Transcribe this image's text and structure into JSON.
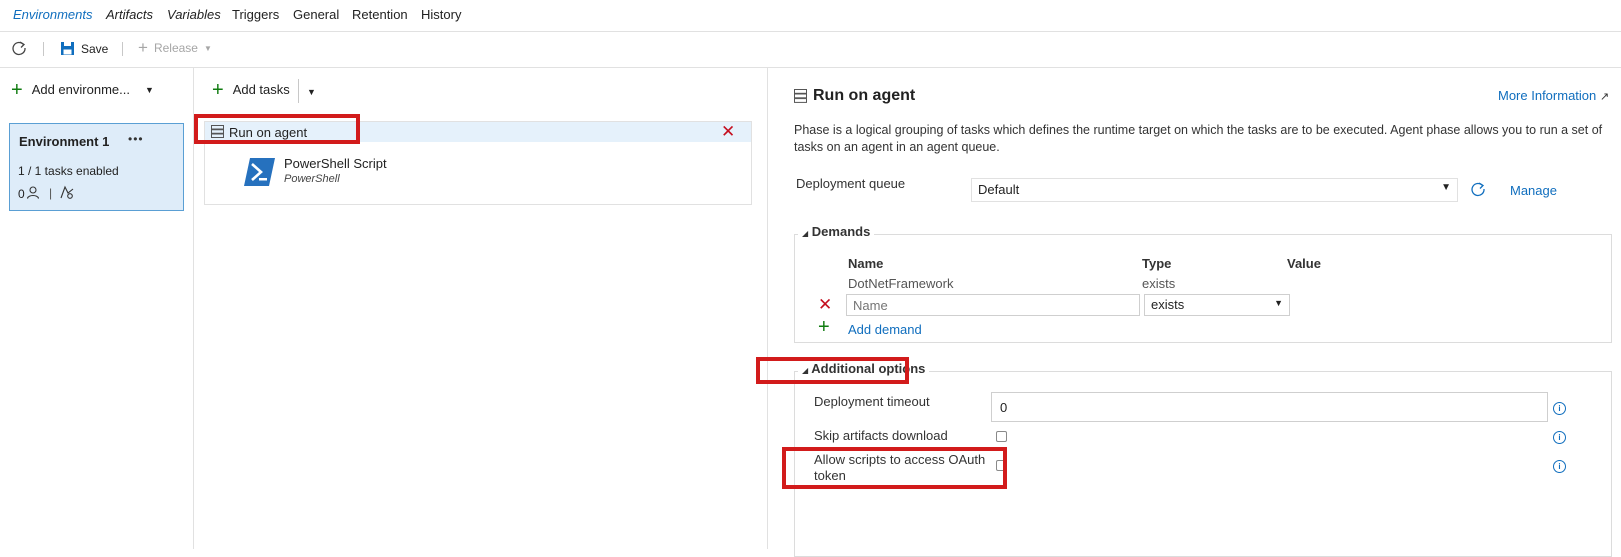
{
  "tabs": [
    {
      "label": "Environments",
      "active": true
    },
    {
      "label": "Artifacts"
    },
    {
      "label": "Variables"
    },
    {
      "label": "Triggers"
    },
    {
      "label": "General"
    },
    {
      "label": "Retention"
    },
    {
      "label": "History"
    }
  ],
  "toolbar": {
    "save_label": "Save",
    "release_label": "Release"
  },
  "left": {
    "add_env_label": "Add environme...",
    "env": {
      "name": "Environment 1",
      "more": "•••",
      "tasks_enabled": "1 / 1 tasks enabled",
      "approvers_count": "0",
      "separator": "|"
    }
  },
  "middle": {
    "add_tasks_label": "Add tasks",
    "phase_label": "Run on agent",
    "task": {
      "name": "PowerShell Script",
      "sub": "PowerShell"
    }
  },
  "right": {
    "title": "Run on agent",
    "more_info": "More Information",
    "description": "Phase is a logical grouping of tasks which defines the runtime target on which the tasks are to be executed. Agent phase allows you to run a set of tasks on an agent in an agent queue.",
    "queue_label": "Deployment queue",
    "queue_value": "Default",
    "manage": "Manage",
    "demands": {
      "legend": "Demands",
      "col_name": "Name",
      "col_type": "Type",
      "col_value": "Value",
      "row_name": "DotNetFramework",
      "row_type": "exists",
      "new_name_placeholder": "Name",
      "new_type": "exists",
      "add": "Add demand"
    },
    "options": {
      "legend": "Additional options",
      "timeout_label": "Deployment timeout",
      "timeout_value": "0",
      "skip_label": "Skip artifacts download",
      "oauth_label_1": "Allow scripts to access OAuth",
      "oauth_label_2": "token"
    }
  },
  "colors": {
    "accent": "#106ebe",
    "highlight": "#d21b1b",
    "selected_bg": "#deecf9",
    "add_green": "#107c10"
  }
}
